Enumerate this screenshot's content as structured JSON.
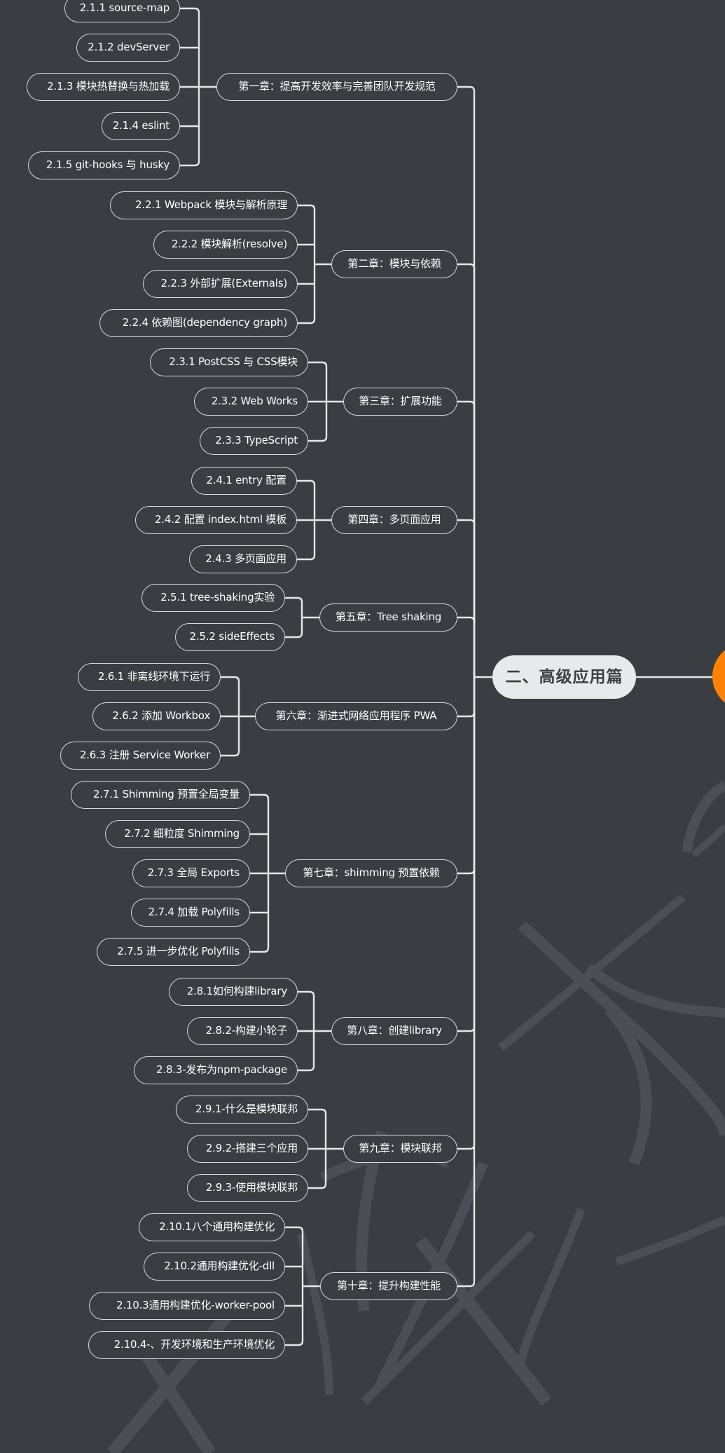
{
  "root": {
    "label": "二、高级应用篇"
  },
  "parent": {
    "label": "",
    "color": "#ff8208"
  },
  "colors": {
    "background": "#3a3d42",
    "line": "#e6e6e6",
    "root_fill": "#e8e9eb",
    "watermark": "#4b4e54"
  },
  "chapters": [
    {
      "label": "第一章：提高开发效率与完善团队开发规范",
      "topics": [
        "2.1.1 source-map",
        "2.1.2 devServer",
        "2.1.3 模块热替换与热加载",
        "2.1.4 eslint",
        "2.1.5 git-hooks 与 husky"
      ]
    },
    {
      "label": "第二章：模块与依赖",
      "topics": [
        "2.2.1 Webpack 模块与解析原理",
        "2.2.2 模块解析(resolve)",
        "2.2.3 外部扩展(Externals)",
        "2.2.4 依赖图(dependency graph)"
      ]
    },
    {
      "label": "第三章：扩展功能",
      "topics": [
        "2.3.1 PostCSS 与 CSS模块",
        "2.3.2 Web Works",
        "2.3.3 TypeScript"
      ]
    },
    {
      "label": "第四章：多页面应用",
      "topics": [
        "2.4.1 entry 配置",
        "2.4.2 配置 index.html 模板",
        "2.4.3 多页面应用"
      ]
    },
    {
      "label": "第五章：Tree shaking",
      "topics": [
        "2.5.1 tree-shaking实验",
        "2.5.2 sideEffects"
      ]
    },
    {
      "label": "第六章：渐进式网络应用程序 PWA",
      "topics": [
        "2.6.1 非离线环境下运行",
        "2.6.2 添加 Workbox",
        "2.6.3 注册 Service Worker"
      ]
    },
    {
      "label": "第七章：shimming 预置依赖",
      "topics": [
        "2.7.1 Shimming 预置全局变量",
        "2.7.2 细粒度 Shimming",
        "2.7.3 全局 Exports",
        "2.7.4 加载 Polyfills",
        "2.7.5 进一步优化 Polyfills"
      ]
    },
    {
      "label": "第八章：创建library",
      "topics": [
        "2.8.1如何构建library",
        "2.8.2-构建小轮子",
        "2.8.3-发布为npm-package"
      ]
    },
    {
      "label": "第九章：模块联邦",
      "topics": [
        "2.9.1-什么是模块联邦",
        "2.9.2-搭建三个应用",
        "2.9.3-使用模块联邦"
      ]
    },
    {
      "label": "第十章：提升构建性能",
      "topics": [
        "2.10.1八个通用构建优化",
        "2.10.2通用构建优化-dll",
        "2.10.3通用构建优化-worker-pool",
        "2.10.4-、开发环境和生产环境优化"
      ]
    }
  ]
}
